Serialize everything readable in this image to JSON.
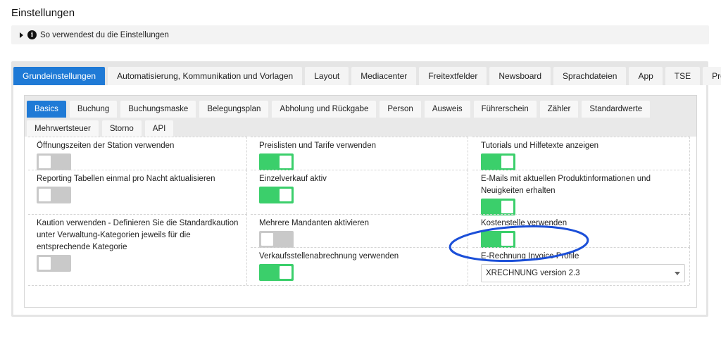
{
  "page": {
    "title": "Einstellungen"
  },
  "info": {
    "text": "So verwendest du die Einstellungen"
  },
  "top_tabs": [
    {
      "label": "Grundeinstellungen",
      "active": true
    },
    {
      "label": "Automatisierung, Kommunikation und Vorlagen",
      "active": false
    },
    {
      "label": "Layout",
      "active": false
    },
    {
      "label": "Mediacenter",
      "active": false
    },
    {
      "label": "Freitextfelder",
      "active": false
    },
    {
      "label": "Newsboard",
      "active": false
    },
    {
      "label": "Sprachdateien",
      "active": false
    },
    {
      "label": "App",
      "active": false
    },
    {
      "label": "TSE",
      "active": false
    },
    {
      "label": "Profi",
      "active": false
    }
  ],
  "sub_tabs_row1": [
    {
      "label": "Basics",
      "active": true
    },
    {
      "label": "Buchung",
      "active": false
    },
    {
      "label": "Buchungsmaske",
      "active": false
    },
    {
      "label": "Belegungsplan",
      "active": false
    },
    {
      "label": "Abholung und Rückgabe",
      "active": false
    },
    {
      "label": "Person",
      "active": false
    },
    {
      "label": "Ausweis",
      "active": false
    },
    {
      "label": "Führerschein",
      "active": false
    },
    {
      "label": "Zähler",
      "active": false
    },
    {
      "label": "Standardwerte",
      "active": false
    }
  ],
  "sub_tabs_row2": [
    {
      "label": "Mehrwertsteuer",
      "active": false
    },
    {
      "label": "Storno",
      "active": false
    },
    {
      "label": "API",
      "active": false
    }
  ],
  "settings": {
    "oeffnungszeiten": {
      "label": "Öffnungszeiten der Station verwenden",
      "enabled": false
    },
    "preislisten": {
      "label": "Preislisten und Tarife verwenden",
      "enabled": true
    },
    "tutorials": {
      "label": "Tutorials und Hilfetexte anzeigen",
      "enabled": true
    },
    "reporting": {
      "label": "Reporting Tabellen einmal pro Nacht aktualisieren",
      "enabled": false
    },
    "einzelverkauf": {
      "label": "Einzelverkauf aktiv",
      "enabled": true
    },
    "emails": {
      "label": "E-Mails mit aktuellen Produktinformationen und Neuigkeiten erhalten",
      "enabled": true
    },
    "kaution": {
      "label": "Kaution verwenden - Definieren Sie die Standardkaution unter Verwaltung-Kategorien jeweils für die entsprechende Kategorie",
      "enabled": false
    },
    "mandanten": {
      "label": "Mehrere Mandanten aktivieren",
      "enabled": false
    },
    "kostenstelle": {
      "label": "Kostenstelle verwenden",
      "enabled": true
    },
    "verkaufsstellen": {
      "label": "Verkaufsstellenabrechnung verwenden",
      "enabled": true
    },
    "erechnung": {
      "label": "E-Rechnung Invoice Profile",
      "value": "XRECHNUNG version 2.3"
    }
  },
  "colors": {
    "accent": "#1f7ad6",
    "toggle_on": "#3bcf6b",
    "toggle_off": "#c9c9c9",
    "highlight": "#1b4fd8"
  }
}
